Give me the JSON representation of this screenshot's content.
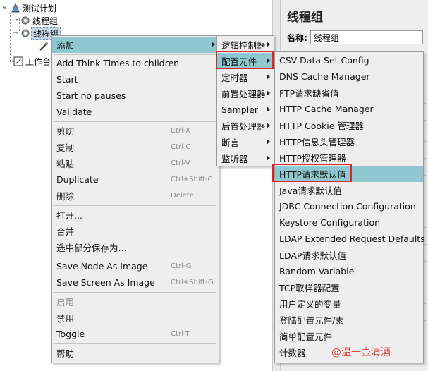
{
  "tree": {
    "root": "测试计划",
    "thread_group_1": "线程组",
    "thread_group_2": "线程组",
    "workbench": "工作台"
  },
  "right_panel": {
    "title": "线程组",
    "name_label": "名称:",
    "name_value": "线程组"
  },
  "menu_main": {
    "items": [
      {
        "label": "添加"
      },
      {
        "label": "Add Think Times to children"
      },
      {
        "label": "Start"
      },
      {
        "label": "Start no pauses"
      },
      {
        "label": "Validate"
      },
      {
        "label": "剪切",
        "shortcut": "Ctrl-X"
      },
      {
        "label": "复制",
        "shortcut": "Ctrl-C"
      },
      {
        "label": "粘贴",
        "shortcut": "Ctrl-V"
      },
      {
        "label": "Duplicate",
        "shortcut": "Ctrl+Shift-C"
      },
      {
        "label": "删除",
        "shortcut": "Delete"
      },
      {
        "label": "打开..."
      },
      {
        "label": "合并"
      },
      {
        "label": "选中部分保存为..."
      },
      {
        "label": "Save Node As Image",
        "shortcut": "Ctrl-G"
      },
      {
        "label": "Save Screen As Image",
        "shortcut": "Ctrl+Shift-G"
      },
      {
        "label": "启用"
      },
      {
        "label": "禁用"
      },
      {
        "label": "Toggle",
        "shortcut": "Ctrl-T"
      },
      {
        "label": "帮助"
      }
    ]
  },
  "menu_add": {
    "items": [
      {
        "label": "逻辑控制器"
      },
      {
        "label": "配置元件"
      },
      {
        "label": "定时器"
      },
      {
        "label": "前置处理器"
      },
      {
        "label": "Sampler"
      },
      {
        "label": "后置处理器"
      },
      {
        "label": "断言"
      },
      {
        "label": "监听器"
      }
    ]
  },
  "menu_config": {
    "items": [
      {
        "label": "CSV Data Set Config"
      },
      {
        "label": "DNS Cache Manager"
      },
      {
        "label": "FTP请求缺省值"
      },
      {
        "label": "HTTP Cache Manager"
      },
      {
        "label": "HTTP Cookie 管理器"
      },
      {
        "label": "HTTP信息头管理器"
      },
      {
        "label": "HTTP授权管理器"
      },
      {
        "label": "HTTP请求默认值"
      },
      {
        "label": "Java请求默认值"
      },
      {
        "label": "JDBC Connection Configuration"
      },
      {
        "label": "Keystore Configuration"
      },
      {
        "label": "LDAP Extended Request Defaults"
      },
      {
        "label": "LDAP请求默认值"
      },
      {
        "label": "Random Variable"
      },
      {
        "label": "TCP取样器配置"
      },
      {
        "label": "用户定义的变量"
      },
      {
        "label": "登陆配置元件/素"
      },
      {
        "label": "简单配置元件"
      },
      {
        "label": "计数器"
      }
    ]
  },
  "watermark": "@温一壶清酒",
  "colors": {
    "highlight": "#8fc8d0",
    "annotation_red": "#d9262a",
    "menu_bg": "#eeeeee"
  }
}
